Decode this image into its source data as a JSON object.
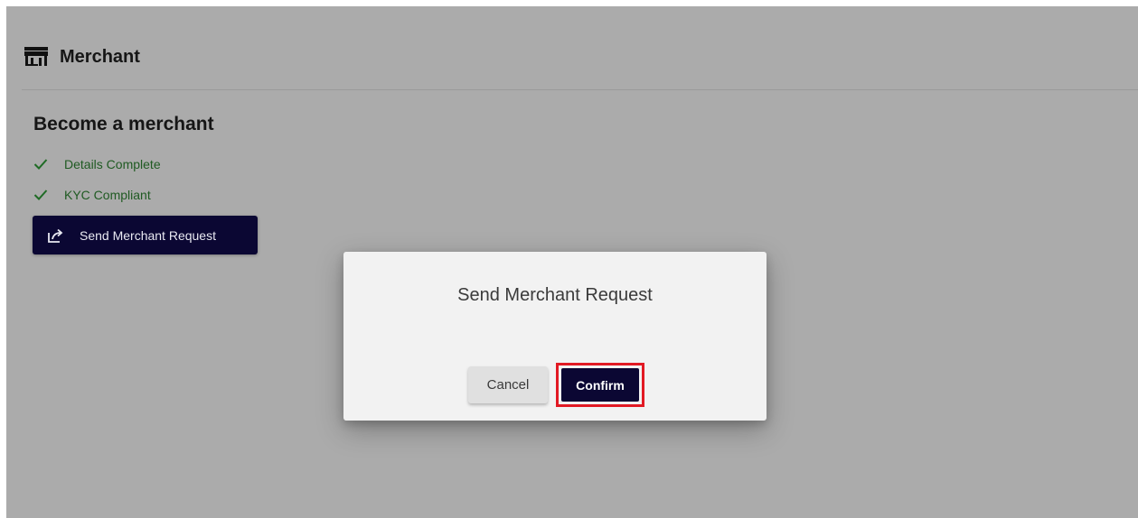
{
  "header": {
    "icon": "storefront-icon",
    "title": "Merchant"
  },
  "section": {
    "title": "Become a merchant",
    "status_items": [
      {
        "icon": "check-icon",
        "label": "Details Complete"
      },
      {
        "icon": "check-icon",
        "label": "KYC Compliant"
      }
    ],
    "request_button": {
      "icon": "share-icon",
      "label": "Send Merchant Request"
    }
  },
  "dialog": {
    "title": "Send Merchant Request",
    "cancel_label": "Cancel",
    "confirm_label": "Confirm"
  },
  "colors": {
    "overlay_background": "#ababab",
    "primary_button": "#0b0733",
    "success_text": "#1f5a22",
    "highlight_border": "#e21a24"
  }
}
